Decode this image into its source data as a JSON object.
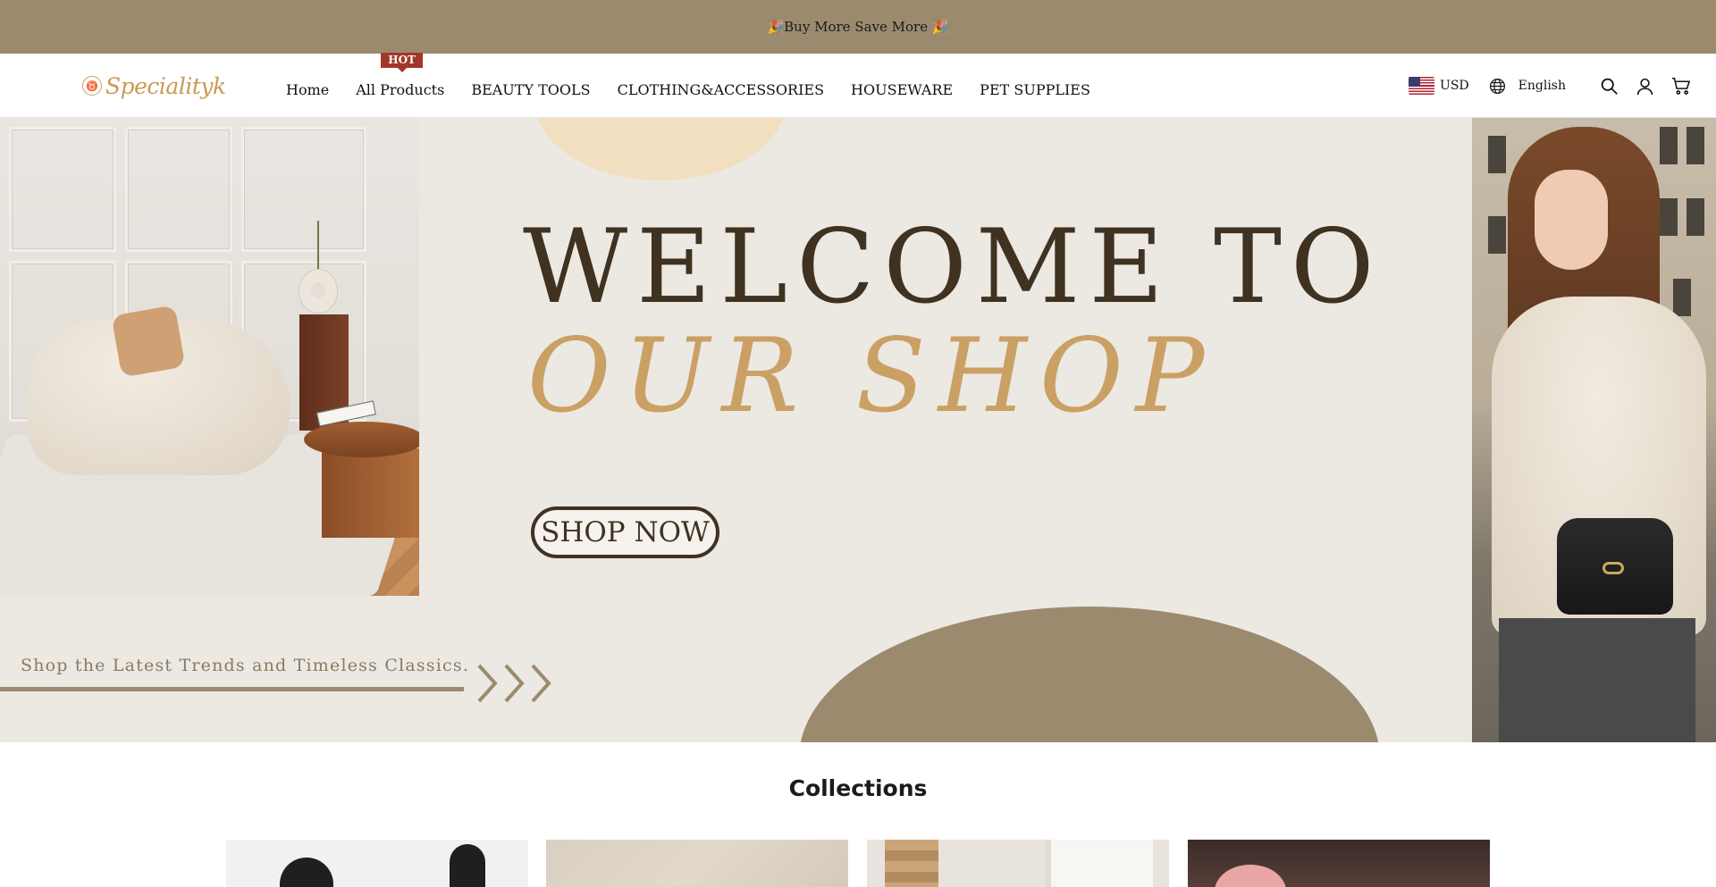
{
  "announcement": {
    "text": "🎉Buy More Save More 🎉"
  },
  "brand": {
    "logo_text": "Specialityk",
    "logo_mark": "♉"
  },
  "nav": {
    "items": [
      {
        "label": "Home"
      },
      {
        "label": "All Products",
        "badge": "HOT"
      },
      {
        "label": "BEAUTY TOOLS"
      },
      {
        "label": "CLOTHING&ACCESSORIES"
      },
      {
        "label": "HOUSEWARE"
      },
      {
        "label": "PET SUPPLIES"
      }
    ]
  },
  "header_utils": {
    "currency": "USD",
    "language": "English",
    "icons": [
      "flag-us-icon",
      "globe-icon",
      "search-icon",
      "account-icon",
      "cart-icon"
    ]
  },
  "hero": {
    "line1": "WELCOME TO",
    "line2": "OUR SHOP",
    "cta": "SHOP NOW",
    "tagline": "Shop the Latest Trends and Timeless Classics."
  },
  "collections": {
    "title": "Collections"
  },
  "colors": {
    "announcement_bg": "#9c8a6f",
    "hot_badge": "#a3362a",
    "logo_gold": "#c89a55",
    "hero_dark": "#3f3220",
    "hero_gold": "#caa064"
  }
}
